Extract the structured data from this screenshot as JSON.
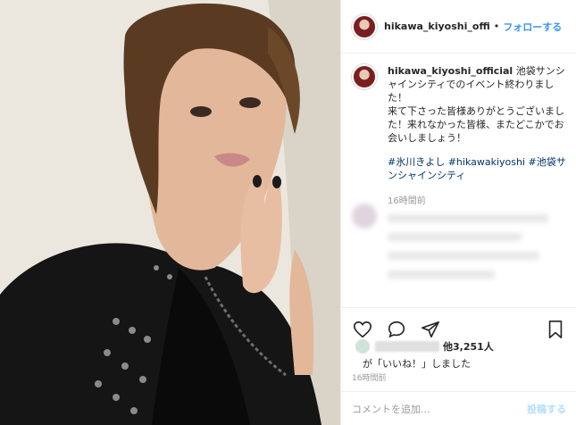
{
  "post": {
    "username": "hikawa_kiyoshi_offi",
    "dot": "•",
    "follow_label": "フォローする"
  },
  "caption": {
    "username": "hikawa_kiyoshi_official",
    "text": "池袋サンシャインシティでのイベント終わりました！\n来て下さった皆様ありがとうございました！来れなかった皆様、またどこかでお会いしましょう！",
    "hashtags": "#氷川きよし #hikawakiyoshi #池袋サンシャインシティ",
    "time": "16時間前"
  },
  "likes": {
    "count_label": "他3,251人",
    "suffix": "が「いいね！」しました"
  },
  "footer": {
    "time": "16時間前",
    "comment_placeholder": "コメントを追加...",
    "post_label": "投稿する"
  },
  "icons": [
    "heart-icon",
    "comment-icon",
    "share-icon",
    "bookmark-icon"
  ],
  "colors": {
    "accent": "#3897f0",
    "text": "#262626",
    "muted": "#999999",
    "border": "#efefef"
  }
}
